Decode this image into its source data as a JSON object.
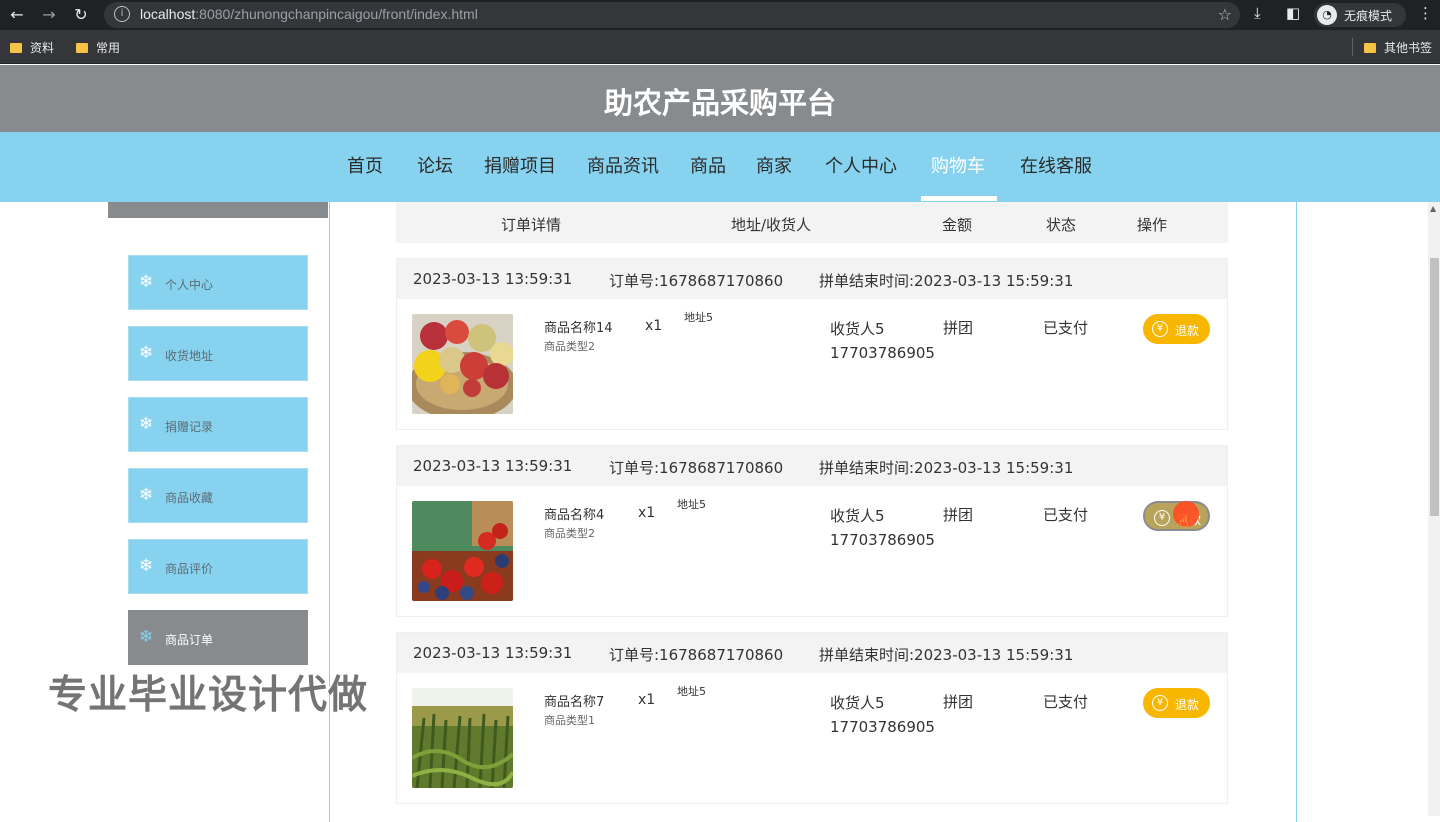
{
  "browser": {
    "url_host": "localhost",
    "url_rest": ":8080/zhunongchanpincaigou/front/index.html",
    "incognito_label": "无痕模式",
    "bookmarks": [
      "资料",
      "常用"
    ],
    "other_bookmarks": "其他书签"
  },
  "site": {
    "title": "助农产品采购平台",
    "nav": [
      "首页",
      "论坛",
      "捐赠项目",
      "商品资讯",
      "商品",
      "商家",
      "个人中心",
      "购物车",
      "在线客服"
    ],
    "active_nav": "购物车"
  },
  "sidebar": {
    "items": [
      "个人中心",
      "收货地址",
      "捐赠记录",
      "商品收藏",
      "商品评价",
      "商品订单"
    ],
    "active": "商品订单"
  },
  "watermark": "专业毕业设计代做",
  "table": {
    "headers": [
      "订单详情",
      "地址/收货人",
      "金额",
      "状态",
      "操作"
    ]
  },
  "orders": [
    {
      "time": "2023-03-13 13:59:31",
      "order_no": "订单号:1678687170860",
      "end_time": "拼单结束时间:2023-03-13 15:59:31",
      "product_name": "商品名称14",
      "product_type": "商品类型2",
      "quantity": "x1",
      "address": "地址5",
      "receiver": "收货人5",
      "phone": "17703786905",
      "amount": "拼团",
      "status": "已支付",
      "action": "退款",
      "image": "fruit-basket"
    },
    {
      "time": "2023-03-13 13:59:31",
      "order_no": "订单号:1678687170860",
      "end_time": "拼单结束时间:2023-03-13 15:59:31",
      "product_name": "商品名称4",
      "product_type": "商品类型2",
      "quantity": "x1",
      "address": "地址5",
      "receiver": "收货人5",
      "phone": "17703786905",
      "amount": "拼团",
      "status": "已支付",
      "action": "退款",
      "image": "strawberries"
    },
    {
      "time": "2023-03-13 13:59:31",
      "order_no": "订单号:1678687170860",
      "end_time": "拼单结束时间:2023-03-13 15:59:31",
      "product_name": "商品名称7",
      "product_type": "商品类型1",
      "quantity": "x1",
      "address": "地址5",
      "receiver": "收货人5",
      "phone": "17703786905",
      "amount": "拼团",
      "status": "已支付",
      "action": "退款",
      "image": "millet-field"
    }
  ]
}
